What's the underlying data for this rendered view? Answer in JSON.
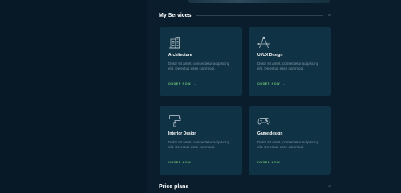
{
  "services_section": {
    "title": "My Services",
    "number": "02"
  },
  "services": [
    {
      "icon": "building-icon",
      "title": "Architecture",
      "desc": "Dolor sit amet, consectetur adipiscing elit. Delectus esse commodi.",
      "cta": "ORDER NOW",
      "arrow": "→"
    },
    {
      "icon": "pen-tool-icon",
      "title": "UI/UX Design",
      "desc": "Dolor sit amet, consectetur adipiscing elit. Delectus esse commodi.",
      "cta": "ORDER NOW",
      "arrow": "→"
    },
    {
      "icon": "paint-roller-icon",
      "title": "Interior Design",
      "desc": "Dolor sit amet, consectetur adipiscing elit. Delectus esse commodi.",
      "cta": "ORDER NOW",
      "arrow": "→"
    },
    {
      "icon": "gamepad-icon",
      "title": "Game design",
      "desc": "Dolor sit amet, consectetur adipiscing elit. Delectus esse commodi.",
      "cta": "ORDER NOW",
      "arrow": "→"
    }
  ],
  "pricing_section": {
    "title": "Price plans",
    "number": "03"
  },
  "colors": {
    "background": "#091d2c",
    "card": "#0f3244",
    "accent": "#6dc274",
    "muted_text": "#7e95a4"
  }
}
